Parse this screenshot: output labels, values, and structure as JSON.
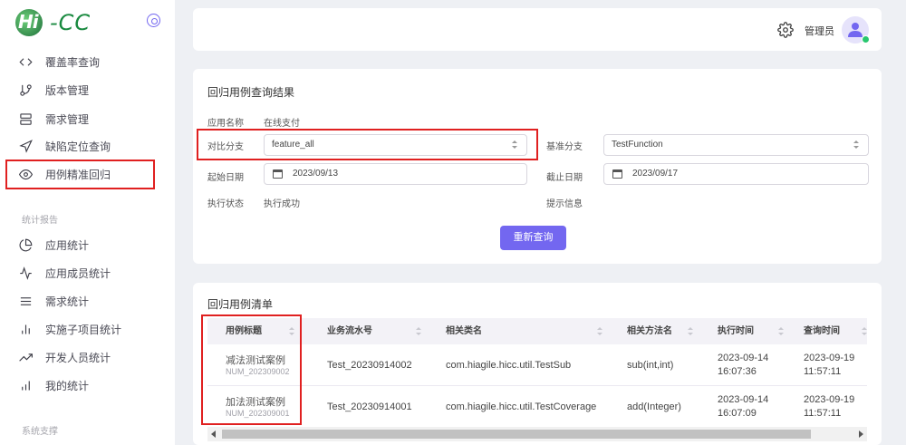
{
  "app": {
    "logo_text_hi": "Hi",
    "logo_text_cc": "-CC"
  },
  "sidebar": {
    "items": [
      {
        "label": "覆盖率查询",
        "icon": "code-icon"
      },
      {
        "label": "版本管理",
        "icon": "git-branch-icon"
      },
      {
        "label": "需求管理",
        "icon": "server-icon"
      },
      {
        "label": "缺陷定位查询",
        "icon": "navigation-icon"
      },
      {
        "label": "用例精准回归",
        "icon": "eye-icon"
      }
    ],
    "section_stats": "统计报告",
    "stats_items": [
      {
        "label": "应用统计",
        "icon": "pie-chart-icon"
      },
      {
        "label": "应用成员统计",
        "icon": "activity-icon"
      },
      {
        "label": "需求统计",
        "icon": "list-icon"
      },
      {
        "label": "实施子项目统计",
        "icon": "bar-chart-icon"
      },
      {
        "label": "开发人员统计",
        "icon": "trending-up-icon"
      },
      {
        "label": "我的统计",
        "icon": "bar-chart-2-icon"
      }
    ],
    "section_support": "系统支撑"
  },
  "header": {
    "admin_label": "管理员"
  },
  "query": {
    "title": "回归用例查询结果",
    "app_name_label": "应用名称",
    "app_name_value": "在线支付",
    "compare_branch_label": "对比分支",
    "compare_branch_value": "feature_all",
    "base_branch_label": "基准分支",
    "base_branch_value": "TestFunction",
    "start_date_label": "起始日期",
    "start_date_value": "2023/09/13",
    "end_date_label": "截止日期",
    "end_date_value": "2023/09/17",
    "exec_status_label": "执行状态",
    "exec_status_value": "执行成功",
    "hint_label": "提示信息",
    "requery_button": "重新查询"
  },
  "cases": {
    "title": "回归用例清单",
    "columns": [
      "用例标题",
      "业务流水号",
      "相关类名",
      "相关方法名",
      "执行时间",
      "查询时间"
    ],
    "rows": [
      {
        "title": "减法测试案例",
        "num": "NUM_202309002",
        "serial": "Test_20230914002",
        "class_name": "com.hiagile.hicc.util.TestSub",
        "method": "sub(int,int)",
        "exec_date": "2023-09-14",
        "exec_time": "16:07:36",
        "query_date": "2023-09-19",
        "query_time": "11:57:11"
      },
      {
        "title": "加法测试案例",
        "num": "NUM_202309001",
        "serial": "Test_20230914001",
        "class_name": "com.hiagile.hicc.util.TestCoverage",
        "method": "add(Integer)",
        "exec_date": "2023-09-14",
        "exec_time": "16:07:09",
        "query_date": "2023-09-19",
        "query_time": "11:57:11"
      }
    ]
  },
  "colors": {
    "accent": "#7367f0",
    "highlight_border": "#e02020",
    "online": "#28c76f"
  }
}
